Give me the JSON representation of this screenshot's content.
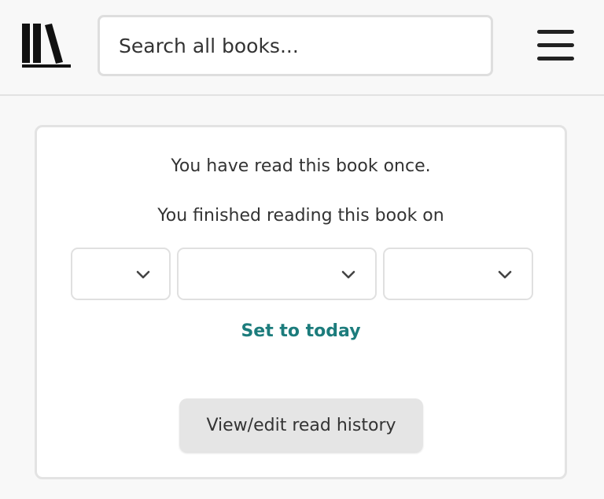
{
  "header": {
    "logo_icon": "bookshelf-logo-icon",
    "search": {
      "placeholder": "Search all books...",
      "value": ""
    },
    "menu_icon": "hamburger-menu-icon"
  },
  "read_status": {
    "read_count_text": "You have read this book once.",
    "finished_text": "You finished reading this book on",
    "date_selects": {
      "day": {
        "value": "",
        "icon": "chevron-down-icon"
      },
      "month": {
        "value": "",
        "icon": "chevron-down-icon"
      },
      "year": {
        "value": "",
        "icon": "chevron-down-icon"
      }
    },
    "set_today_label": "Set to today",
    "history_button_label": "View/edit read history"
  },
  "colors": {
    "link": "#1c7c7c",
    "background": "#f8f8f8",
    "card": "#ffffff",
    "button": "#e5e5e5"
  }
}
